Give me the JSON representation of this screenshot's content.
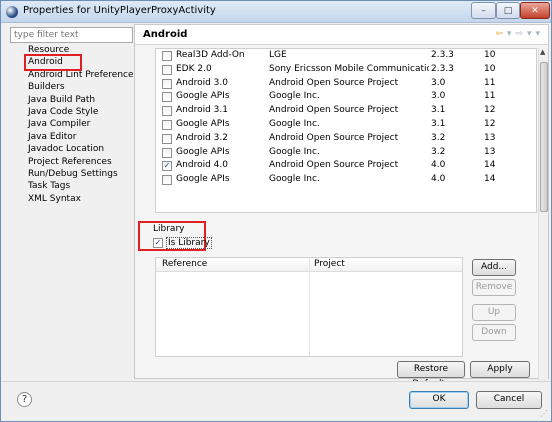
{
  "window": {
    "title": "Properties for UnityPlayerProxyActivity",
    "min": "–",
    "max": "□",
    "close": "✕"
  },
  "filter": {
    "placeholder": "type filter text"
  },
  "nav": {
    "items": [
      "Resource",
      "Android",
      "Android Lint Preferences",
      "Builders",
      "Java Build Path",
      "Java Code Style",
      "Java Compiler",
      "Java Editor",
      "Javadoc Location",
      "Project References",
      "Run/Debug Settings",
      "Task Tags",
      "XML Syntax"
    ],
    "selected_index": 1
  },
  "page": {
    "title": "Android",
    "back_arrow": "⇦",
    "menu_arrow": "▾",
    "forward_arrow": "⇨",
    "menu_arrow2": "▾",
    "view_menu": "▾"
  },
  "targets": [
    {
      "name": "Real3D Add-On",
      "vendor": "LGE",
      "platform": "2.3.3",
      "api": "10",
      "checked": false
    },
    {
      "name": "EDK 2.0",
      "vendor": "Sony Ericsson Mobile Communications…",
      "platform": "2.3.3",
      "api": "10",
      "checked": false
    },
    {
      "name": "Android 3.0",
      "vendor": "Android Open Source Project",
      "platform": "3.0",
      "api": "11",
      "checked": false
    },
    {
      "name": "Google APIs",
      "vendor": "Google Inc.",
      "platform": "3.0",
      "api": "11",
      "checked": false
    },
    {
      "name": "Android 3.1",
      "vendor": "Android Open Source Project",
      "platform": "3.1",
      "api": "12",
      "checked": false
    },
    {
      "name": "Google APIs",
      "vendor": "Google Inc.",
      "platform": "3.1",
      "api": "12",
      "checked": false
    },
    {
      "name": "Android 3.2",
      "vendor": "Android Open Source Project",
      "platform": "3.2",
      "api": "13",
      "checked": false
    },
    {
      "name": "Google APIs",
      "vendor": "Google Inc.",
      "platform": "3.2",
      "api": "13",
      "checked": false
    },
    {
      "name": "Android 4.0",
      "vendor": "Android Open Source Project",
      "platform": "4.0",
      "api": "14",
      "checked": true
    },
    {
      "name": "Google APIs",
      "vendor": "Google Inc.",
      "platform": "4.0",
      "api": "14",
      "checked": false
    }
  ],
  "library": {
    "group_label": "Library",
    "is_library_label": "Is Library",
    "is_library_checked": true,
    "checkmark": "✓",
    "columns": [
      "Reference",
      "Project"
    ]
  },
  "buttons": {
    "add": "Add...",
    "remove": "Remove",
    "up": "Up",
    "down": "Down",
    "restore_defaults": "Restore Defaults",
    "apply": "Apply",
    "ok": "OK",
    "cancel": "Cancel"
  },
  "scroll": {
    "up": "▲",
    "down": "▼"
  },
  "help": "?",
  "grip": "⋰",
  "colors": {
    "highlight_box": "#e02020",
    "title_bar": "#c4d6ec",
    "close_button": "#c3412b"
  }
}
